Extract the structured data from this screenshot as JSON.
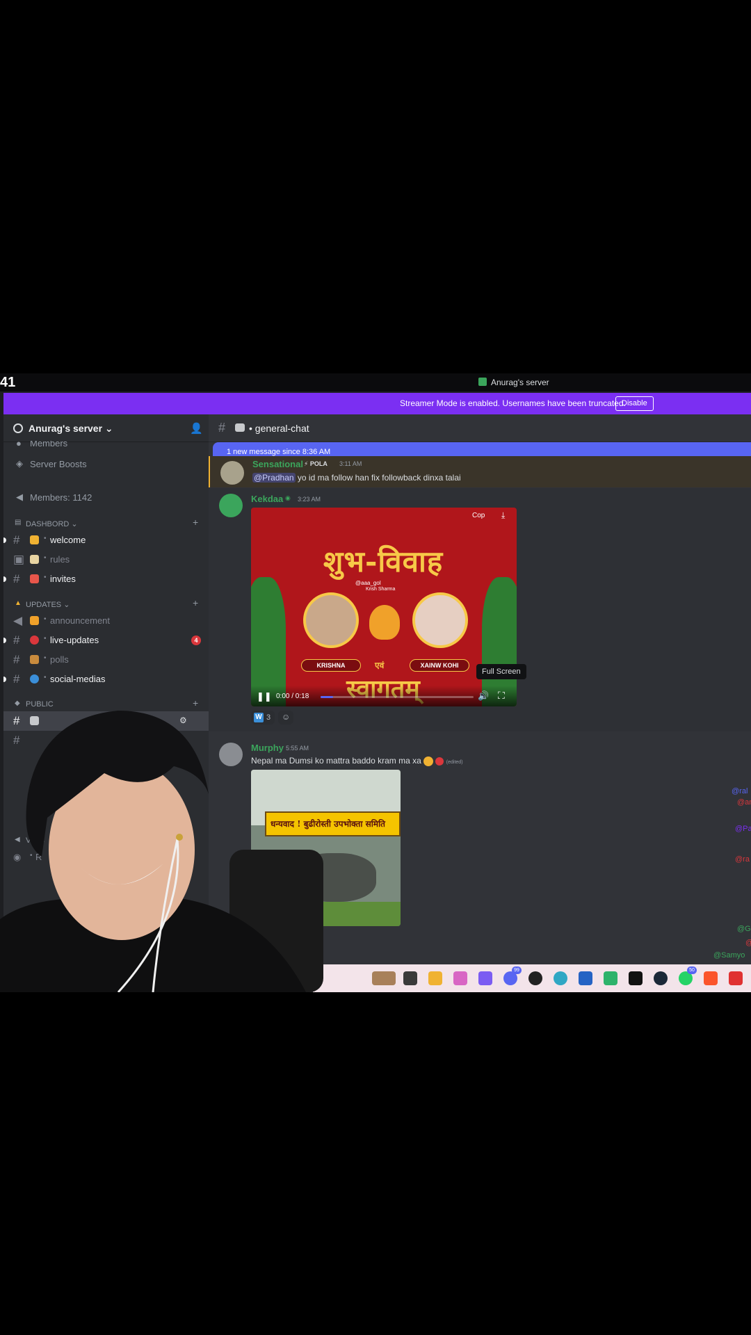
{
  "window": {
    "clock": "41",
    "title": "Anurag's server"
  },
  "banner": {
    "message": "Streamer Mode is enabled. Usernames have been truncated.",
    "disable_label": "Disable"
  },
  "sidebar": {
    "server_name": "Anurag's server",
    "top_items": [
      {
        "label": "Members",
        "icon": "people-icon"
      },
      {
        "label": "Server Boosts",
        "icon": "boost-icon"
      },
      {
        "label": "Members: 1142",
        "icon": "megaphone-icon"
      }
    ],
    "categories": [
      {
        "label": "DASHBORD",
        "icon": "scroll-icon"
      },
      {
        "label": "UPDATES",
        "icon": "bell-icon"
      },
      {
        "label": "PUBLIC",
        "icon": "speech-icon"
      },
      {
        "label": "VOIC",
        "icon": "speaker-icon"
      }
    ],
    "channels": [
      {
        "name": "welcome",
        "emoji_color": "#f0b232",
        "unread": true
      },
      {
        "name": "rules",
        "emoji_color": "#e8d4a2",
        "unread": false
      },
      {
        "name": "invites",
        "emoji_color": "#e8564b",
        "unread": true
      },
      {
        "name": "announcement",
        "emoji_color": "#f0a12a",
        "unread": false
      },
      {
        "name": "live-updates",
        "emoji_color": "#da373c",
        "unread": true,
        "badge": "4"
      },
      {
        "name": "polls",
        "emoji_color": "#c98b3d",
        "unread": false
      },
      {
        "name": "social-medias",
        "emoji_color": "#3b8fd9",
        "unread": true
      }
    ],
    "voice_partial": "R"
  },
  "channel": {
    "name": "general-chat",
    "new_messages": "1 new message since 8:36 AM"
  },
  "messages": [
    {
      "user": "Sensational",
      "user_color": "#3ba55c",
      "tag": "POLA",
      "time": "3:11 AM",
      "mention": "@Pradhan",
      "text": "yo id ma follow han fix followback dinxa talai"
    },
    {
      "user": "Kekdaa",
      "user_color": "#3ba55c",
      "time": "3:23 AM",
      "video": {
        "headline": "शुभ-विवाह",
        "caption": "Krish Sharma",
        "handle": "@aaa_gol",
        "name_left": "KRISHNA",
        "name_mid": "एवं",
        "name_right": "XAINW KOHI",
        "welcome": "स्वागतम्",
        "copy": "Cop",
        "time": "0:00 / 0:18",
        "progress": 0.08,
        "tooltip": "Full Screen"
      },
      "reactions": [
        {
          "emoji": "W",
          "count": "3"
        }
      ]
    },
    {
      "user": "Murphy",
      "user_color": "#3ba55c",
      "time": "5:55 AM",
      "text": "Nepal ma Dumsi ko mattra baddo kram ma xa",
      "edited": "(edited)",
      "photo_sign": "धन्यवाद ! बुढीरोस्ती उपभोक्ता समिति"
    }
  ],
  "edge_mentions": [
    {
      "text": "@ral",
      "color": "#5865f2"
    },
    {
      "text": "@an",
      "color": "#da373c"
    },
    {
      "text": "@Pa",
      "color": "#7b2ff2"
    },
    {
      "text": "@ra",
      "color": "#da373c"
    },
    {
      "text": "@G",
      "color": "#3ba55c"
    },
    {
      "text": "@",
      "color": "#da373c"
    },
    {
      "text": "@Samyo",
      "color": "#3ba55c"
    }
  ],
  "taskbar": {
    "discord_badge": "99",
    "whatsapp_badge": "50"
  }
}
